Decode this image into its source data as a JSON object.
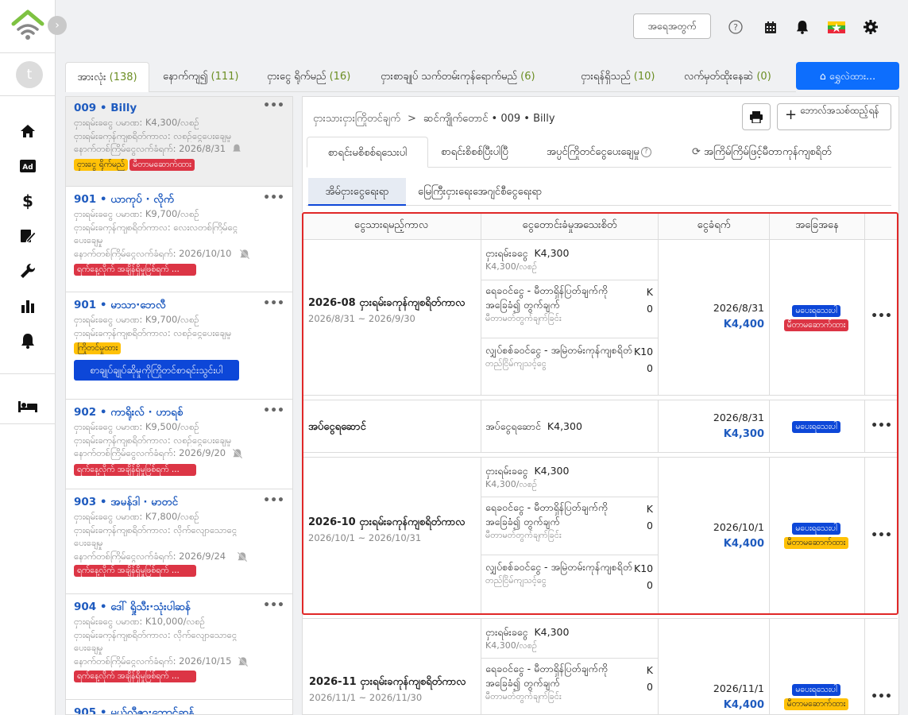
{
  "topbar": {
    "logout_label": "အရေအတွက်"
  },
  "user": {
    "avatar_letter": "t"
  },
  "filter_tabs": [
    {
      "label": "အားလုံး",
      "count": "(138)"
    },
    {
      "label": "နောက်ကျ၍",
      "count": "(111)"
    },
    {
      "label": "ငှားငွေ ရိုက်မည်",
      "count": "(16)"
    },
    {
      "label": "ငှားစာချုပ် သက်တမ်းကုန်ရောက်မည်",
      "count": "(6)"
    },
    {
      "label": "ငှားရန်ရှိသည်",
      "count": "(10)"
    },
    {
      "label": "လက်မှတ်ထိုးနေဆဲ",
      "count": "(0)"
    }
  ],
  "parked_button": "ရွှေလဲထား...",
  "tenants": [
    {
      "name": "009 • Billy",
      "lines": [
        "ငှားရမ်းခငွေ ပမာဏ: K4,300/လစဉ်",
        "ငှားရမ်းခကုန်ကျစရိတ်ကာလ: လစဉ်ငွေပေးချေမှု",
        "နောက်တစ်ကြိမ်ငွေလက်ခံရက်:  2026/8/31"
      ],
      "badges": [
        {
          "text": "ငှားငွေ ရိုက်မည်",
          "color": "yellow"
        },
        {
          "text": "မီတာမဆောက်ထား",
          "color": "red"
        }
      ]
    },
    {
      "name": "901 • ယာကုပ် · လိုက်",
      "lines": [
        "ငှားရမ်းခငွေ ပမာဏ: K9,700/လစဉ်",
        "ငှားရမ်းခကုန်ကျစရိတ်ကာလ: လေးလတစ်ကြိမ်ငွေ",
        "ပေးချေမှု",
        "နောက်တစ်ကြိမ်ငွေလက်ခံရက်:  2026/10/10"
      ],
      "badges": [
        {
          "text": "ရက်နေ့လိုက် အချိန်ရှိမှုဖြစ်ရက် ...",
          "color": "red"
        }
      ]
    },
    {
      "name": "901 • မာသာ·ဘေလီ",
      "lines": [
        "ငှားရမ်းခငွေ ပမာဏ: K9,700/လစဉ်",
        "ငှားရမ်းခကုန်ကျစရိတ်ကာလ: လစဉ်ငွေပေးချေမှု"
      ],
      "badges": [
        {
          "text": "ကြိုတင်မှုထား",
          "color": "yellow"
        }
      ],
      "button": "စာချုပ်ချုပ်ဆိုမှုကိုကြိုတင်စာရင်းသွင်းပါ"
    },
    {
      "name": "902 • ကာရိုးလ် · ဟာရစ်",
      "lines": [
        "ငှားရမ်းခငွေ ပမာဏ: K9,500/လစဉ်",
        "ငှားရမ်းခကုန်ကျစရိတ်ကာလ: လစဉ်ငွေပေးချေမှု",
        "နောက်တစ်ကြိမ်ငွေလက်ခံရက်:  2026/9/20"
      ],
      "badges": [
        {
          "text": "ရက်နေ့လိုက် အချိန်ရှိမှုဖြစ်ရက် ...",
          "color": "red"
        }
      ]
    },
    {
      "name": "903 • အမန်ဒါ · မာတင်",
      "lines": [
        "ငှားရမ်းခငွေ ပမာဏ: K7,800/လစဉ်",
        "ငှားရမ်းခကုန်ကျစရိတ်ကာလ: လိုက်လျောသောငွေ",
        "ပေးချေမှု",
        "နောက်တစ်ကြိမ်ငွေလက်ခံရက်:  2026/9/24"
      ],
      "badges": [
        {
          "text": "ရက်နေ့လိုက် အချိန်ရှိမှုဖြစ်ရက် ...",
          "color": "red"
        }
      ]
    },
    {
      "name": "904 • ဒေါ် ရှိုသီး·သုံးပါဆန်",
      "lines": [
        "ငှားရမ်းခငွေ ပမာဏ: K10,000/လစဉ်",
        "ငှားရမ်းခကုန်ကျစရိတ်ကာလ: လိုက်လျောသောငွေ",
        "ပေးချေမှု",
        "နောက်တစ်ကြိမ်ငွေလက်ခံရက်:  2026/10/15"
      ],
      "badges": [
        {
          "text": "ရက်နေ့လိုက် အချိန်ရှိမှုဖြစ်ရက် ...",
          "color": "red"
        }
      ]
    },
    {
      "name": "905 • မယ်လီဇာ·ဘောင်ဆန်",
      "lines": [],
      "badges": []
    }
  ],
  "breadcrumb": {
    "parent": "ငှားသားငှားကြိုတင်ချက်",
    "sep": ">",
    "current": "ဆင်ကျိုက်တောင် • 009 • Billy"
  },
  "add_charge_button": "ဘောလ်အသစ်ထည့်ရန်",
  "detail_tabs": [
    "စာရင်းမစိစစ်ရသေးပါ",
    "စာရင်းစိစစ်ပြီးပါပြီ",
    "အပ္ပင်ကြိုတင်ငွေပေးချေမှု",
    "အကြိမ်ကြိမ်ဖြင့်မီတာကုန်ကျစရိတ်"
  ],
  "sub_tabs": [
    "အိမ်ငှားငွေရေးရာ",
    "မြေကြီးငှားရေးအေဂျင်စီငွေရေးရာ"
  ],
  "table": {
    "headers": [
      "ငွေသားရမည့်ကာလ",
      "ငွေတောင်းခံမှုအသေးစိတ်",
      "ငွေခံရက်",
      "အခြေအနေ"
    ],
    "rows": [
      {
        "period": "2026-08 ငှားရမ်းခကုန်ကျစရိတ်ကာလ",
        "range": "2026/8/31 ~ 2026/9/30",
        "charges": [
          {
            "name": "ငှားရမ်းခငွေ",
            "amount": "K4,300",
            "sub": "K4,300/လစဉ်"
          },
          {
            "name": "ရေခဝင်ငွေ - မီတာရှိန်ပြတ်ချက်ကို အခြေခံ၍ တွက်ချက်",
            "amount": "K 0",
            "sub": "မီတာမတ်တွက်ချက်ခြင်း"
          },
          {
            "name": "လျှပ်စစ်ခဝင်ငွေ - အမြဲတမ်းကုန်ကျစရိတ်",
            "amount": "K10 0",
            "sub": "တည်ငြိမ်ကျသင့်ငွေ"
          }
        ],
        "date": "2026/8/31",
        "total": "K4,400",
        "status": [
          {
            "text": "မပေးရသေးပါ",
            "color": "blue"
          },
          {
            "text": "မီတာမဆောက်ထား",
            "color": "red"
          }
        ]
      },
      {
        "period": "အပ်ငွေရဆောင်",
        "range": "",
        "charges": [
          {
            "name": "အပ်ငွေရဆောင်",
            "amount": "K4,300",
            "sub": ""
          }
        ],
        "date": "2026/8/31",
        "total": "K4,300",
        "status": [
          {
            "text": "မပေးရသေးပါ",
            "color": "blue"
          }
        ]
      },
      {
        "period": "2026-10 ငှားရမ်းခကုန်ကျစရိတ်ကာလ",
        "range": "2026/10/1 ~ 2026/10/31",
        "charges": [
          {
            "name": "ငှားရမ်းခငွေ",
            "amount": "K4,300",
            "sub": "K4,300/လစဉ်"
          },
          {
            "name": "ရေခဝင်ငွေ - မီတာရှိန်ပြတ်ချက်ကို အခြေခံ၍ တွက်ချက်",
            "amount": "K 0",
            "sub": "မီတာမတ်တွက်ချက်ခြင်း"
          },
          {
            "name": "လျှပ်စစ်ခဝင်ငွေ - အမြဲတမ်းကုန်ကျစရိတ်",
            "amount": "K10 0",
            "sub": "တည်ငြိမ်ကျသင့်ငွေ"
          }
        ],
        "date": "2026/10/1",
        "total": "K4,400",
        "status": [
          {
            "text": "မပေးရသေးပါ",
            "color": "blue"
          },
          {
            "text": "မီတာမဆောက်ထား",
            "color": "yellow"
          }
        ]
      },
      {
        "period": "2026-11 ငှားရမ်းခကုန်ကျစရိတ်ကာလ",
        "range": "2026/11/1 ~ 2026/11/30",
        "charges": [
          {
            "name": "ငှားရမ်းခငွေ",
            "amount": "K4,300",
            "sub": "K4,300/လစဉ်"
          },
          {
            "name": "ရေခဝင်ငွေ - မီတာရှိန်ပြတ်ချက်ကို အခြေခံ၍ တွက်ချက်",
            "amount": "K 0",
            "sub": "မီတာမတ်တွက်ချက်ခြင်း"
          }
        ],
        "date": "2026/11/1",
        "total": "K4,400",
        "status": [
          {
            "text": "မပေးရသေးပါ",
            "color": "blue"
          },
          {
            "text": "မီတာမဆောက်ထား",
            "color": "yellow"
          }
        ]
      }
    ]
  },
  "colors": {
    "accent": "#0d6efd",
    "link": "#1f5bbf",
    "danger": "#dc3545",
    "warning": "#ffc107",
    "highlight_border": "#e02828"
  }
}
